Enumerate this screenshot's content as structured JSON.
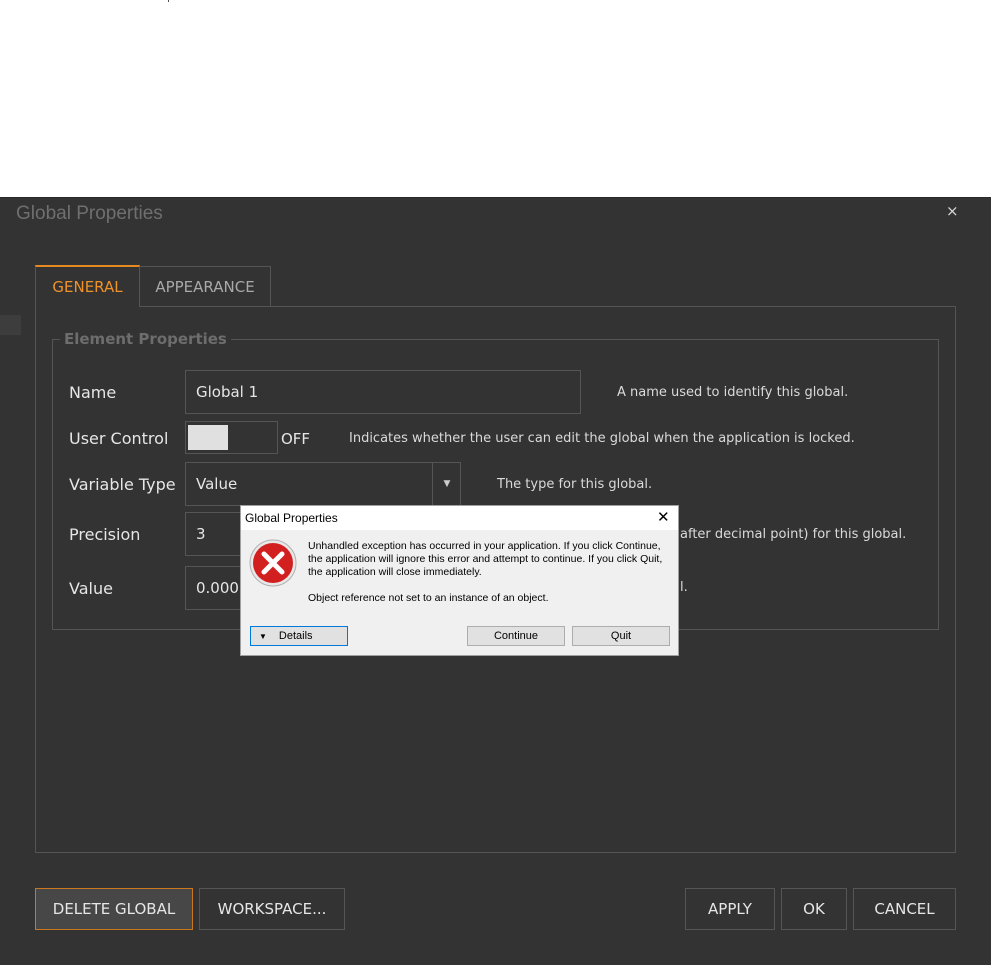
{
  "dialog": {
    "title": "Global Properties",
    "close_glyph": "×"
  },
  "tabs": [
    {
      "label": "GENERAL",
      "active": true
    },
    {
      "label": "APPEARANCE",
      "active": false
    }
  ],
  "fieldset": {
    "legend": "Element Properties",
    "rows": {
      "name": {
        "label": "Name",
        "value": "Global 1",
        "hint": "A name used to identify this global."
      },
      "user_control": {
        "label": "User Control",
        "state": "OFF",
        "hint": "Indicates whether the user can edit the global when the application is locked."
      },
      "variable_type": {
        "label": "Variable Type",
        "value": "Value",
        "hint": "The type for this global."
      },
      "precision": {
        "label": "Precision",
        "value": "3",
        "hint": "after decimal point) for this global."
      },
      "value": {
        "label": "Value",
        "value": "0.000",
        "hint": "l."
      }
    }
  },
  "buttons": {
    "delete": "DELETE GLOBAL",
    "workspace": "WORKSPACE...",
    "apply": "APPLY",
    "ok": "OK",
    "cancel": "CANCEL"
  },
  "error_dialog": {
    "title": "Global Properties",
    "close_glyph": "✕",
    "message": "Unhandled exception has occurred in your application. If you click Continue, the application will ignore this error and attempt to continue. If you click Quit, the application will close immediately.",
    "detail": "Object reference not set to an instance of an object.",
    "details_label": "Details",
    "continue_label": "Continue",
    "quit_label": "Quit",
    "icon": "error-icon"
  },
  "colors": {
    "accent": "#e58a20",
    "background": "#333333",
    "error_red": "#d21f1f"
  }
}
